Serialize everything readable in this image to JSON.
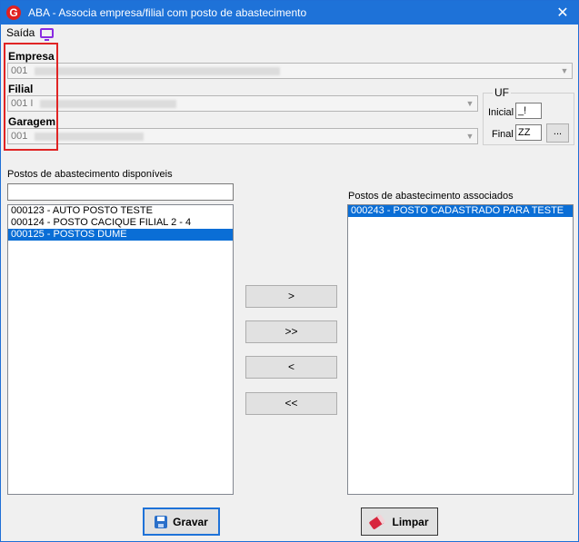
{
  "window": {
    "title": "ABA - Associa empresa/filial com posto de abastecimento",
    "app_icon_letter": "G",
    "close_glyph": "✕"
  },
  "menu": {
    "saida_label": "Saída"
  },
  "empresa": {
    "label": "Empresa",
    "value": "001"
  },
  "filial": {
    "label": "Filial",
    "value": "001 I"
  },
  "garagem": {
    "label": "Garagem",
    "value": "001"
  },
  "uf": {
    "title": "UF",
    "inicial_label": "Inicial",
    "inicial_value": "_!",
    "final_label": "Final",
    "final_value": "ZZ",
    "lookup_label": "..."
  },
  "disponiveis": {
    "label": "Postos de abastecimento disponíveis",
    "filter_value": "",
    "items": [
      "000123 - AUTO POSTO TESTE",
      "000124 - POSTO CACIQUE FILIAL 2 - 4",
      "000125 - POSTOS DUME"
    ],
    "selected_index": 2
  },
  "associados": {
    "label": "Postos de abastecimento associados",
    "items": [
      "000243 - POSTO CADASTRADO PARA TESTE"
    ],
    "selected_index": 0
  },
  "move_buttons": {
    "add_one": ">",
    "add_all": ">>",
    "remove_one": "<",
    "remove_all": "<<"
  },
  "actions": {
    "save_label": "Gravar",
    "clear_label": "Limpar"
  },
  "colors": {
    "titlebar": "#1e72d8",
    "selection": "#0a6ed6",
    "highlight_box": "#e02424",
    "menu_icon": "#8a2be2"
  }
}
